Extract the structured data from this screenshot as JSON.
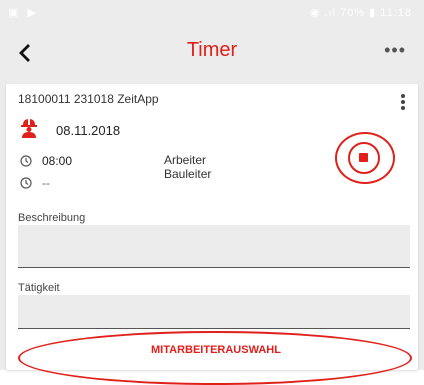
{
  "statusbar": {
    "left_icons": "▣ ▶",
    "right_text": "◉ .ıl 70% ▮ 11:18"
  },
  "appbar": {
    "back_icon": "chevron-left-icon",
    "back_glyph": "‹",
    "title": "Timer",
    "more_icon": "more-horizontal-icon",
    "more_glyph": "•••"
  },
  "card": {
    "title": "18100011 231018 ZeitApp",
    "menu_icon": "more-vertical-icon",
    "worker_icon": "construction-worker-icon",
    "date": "08.11.2018",
    "start_time": "08:00",
    "end_time": "--",
    "roles": [
      "Arbeiter",
      "Bauleiter"
    ],
    "stop_icon": "stop-circle-icon",
    "accent_color": "#e0201b"
  },
  "fields": {
    "beschreibung_label": "Beschreibung",
    "beschreibung_value": "",
    "taetigkeit_label": "Tätigkeit",
    "taetigkeit_value": ""
  },
  "actions": {
    "select_employees_label": "MITARBEITERAUSWAHL"
  }
}
